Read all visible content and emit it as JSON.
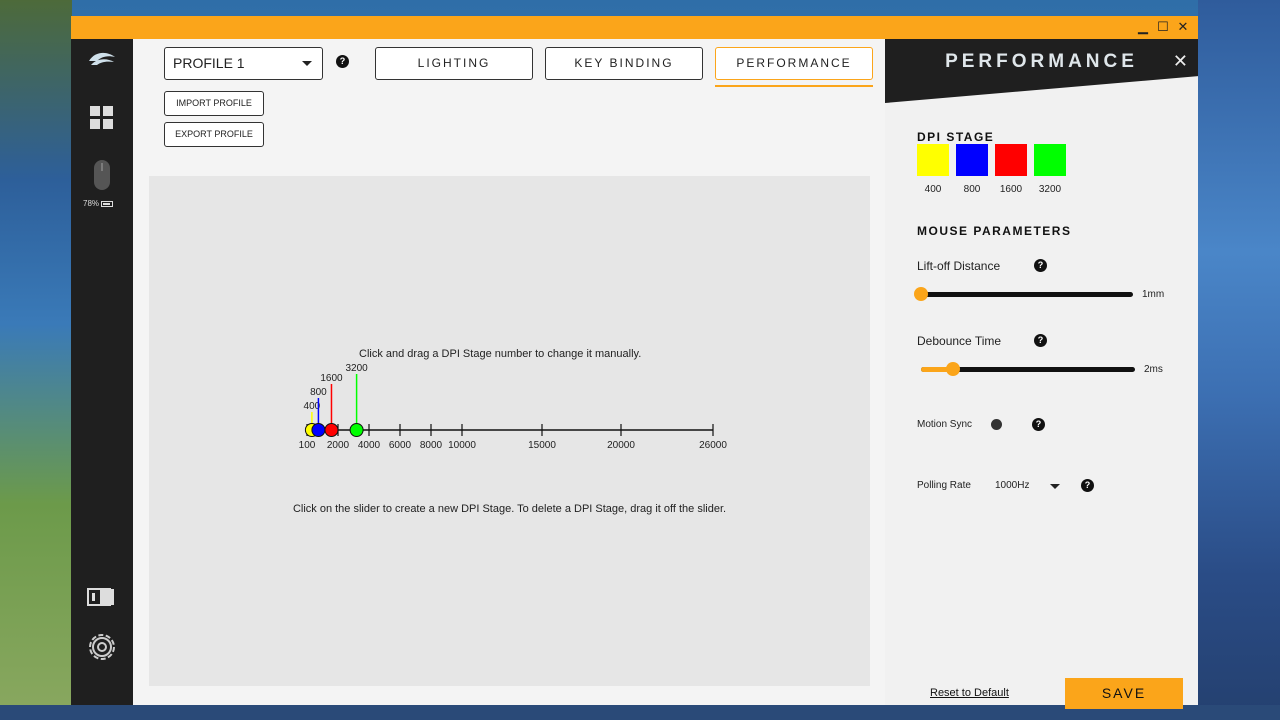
{
  "window": {
    "controls": {
      "minimize": "▁",
      "maximize": "☐",
      "close": "✕"
    }
  },
  "sidebar": {
    "battery": "78%",
    "icons": [
      "logo-icon",
      "grid-icon",
      "mouse-icon",
      "device-switch-icon",
      "gear-icon"
    ]
  },
  "main": {
    "profile": {
      "selected": "PROFILE 1",
      "help": "?"
    },
    "tabs": [
      {
        "label": "LIGHTING"
      },
      {
        "label": "KEY BINDING"
      },
      {
        "label": "PERFORMANCE"
      }
    ],
    "import_label": "IMPORT PROFILE",
    "export_label": "EXPORT PROFILE",
    "dpi_slider": {
      "hint_top": "Click and drag a DPI Stage number to change it manually.",
      "hint_bottom": "Click on the slider to create a new DPI Stage. To delete a DPI Stage, drag it off the slider.",
      "ticks": [
        "100",
        "2000",
        "4000",
        "6000",
        "8000",
        "10000",
        "15000",
        "20000",
        "26000"
      ],
      "stages": [
        {
          "value": 400,
          "label": "400",
          "color": "#ffff00"
        },
        {
          "value": 800,
          "label": "800",
          "color": "#0000ff"
        },
        {
          "value": 1600,
          "label": "1600",
          "color": "#ff0000"
        },
        {
          "value": 3200,
          "label": "3200",
          "color": "#00ff00"
        }
      ]
    }
  },
  "panel": {
    "title": "PERFORMANCE",
    "close": "✕",
    "dpi_stage_heading": "DPI STAGE",
    "stages": [
      {
        "label": "400",
        "color": "#ffff00"
      },
      {
        "label": "800",
        "color": "#0000ff"
      },
      {
        "label": "1600",
        "color": "#ff0000"
      },
      {
        "label": "3200",
        "color": "#00ff00"
      }
    ],
    "mouse_params_heading": "MOUSE PARAMETERS",
    "liftoff": {
      "label": "Lift-off Distance",
      "value": "1mm",
      "level": 0.0
    },
    "debounce": {
      "label": "Debounce Time",
      "value": "2ms",
      "level": 0.15
    },
    "motion_sync": {
      "label": "Motion Sync"
    },
    "polling": {
      "label": "Polling Rate",
      "value": "1000Hz"
    },
    "reset_label": "Reset to Default",
    "save_label": "SAVE"
  },
  "colors": {
    "accent": "#fba51a",
    "sidebar": "#1f1f1f"
  }
}
